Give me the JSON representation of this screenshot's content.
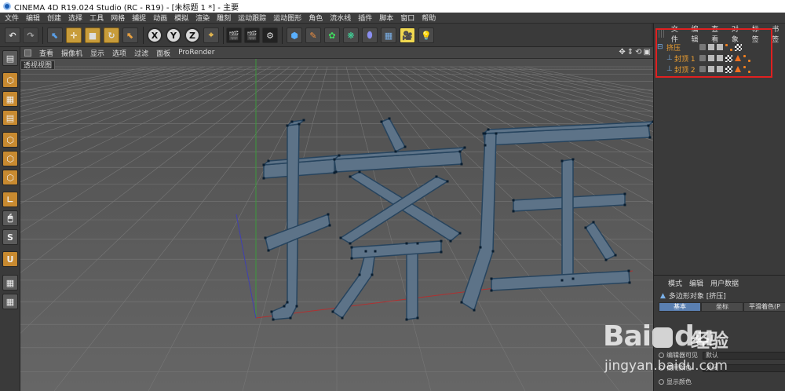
{
  "window": {
    "title": "CINEMA 4D R19.024 Studio (RC - R19) - [未标题 1 *] - 主要"
  },
  "menubar": [
    "文件",
    "编辑",
    "创建",
    "选择",
    "工具",
    "网格",
    "捕捉",
    "动画",
    "模拟",
    "渲染",
    "雕刻",
    "运动跟踪",
    "运动图形",
    "角色",
    "流水线",
    "插件",
    "脚本",
    "窗口",
    "帮助"
  ],
  "toolbar": {
    "axis_x": "X",
    "axis_y": "Y",
    "axis_z": "Z"
  },
  "viewport": {
    "menu": [
      "查看",
      "摄像机",
      "显示",
      "选项",
      "过滤",
      "面板",
      "ProRender"
    ],
    "label": "透视视图",
    "nav_icons": [
      "move-icon",
      "zoom-icon",
      "rotate-icon",
      "maximize-icon"
    ]
  },
  "object_manager": {
    "menu": [
      "文件",
      "编辑",
      "查看",
      "对象",
      "标签",
      "书签"
    ],
    "objects": [
      {
        "name": "挤压",
        "level": 0
      },
      {
        "name": "封顶 1",
        "level": 1
      },
      {
        "name": "封顶 2",
        "level": 1
      }
    ]
  },
  "attribute_manager": {
    "menu": [
      "模式",
      "编辑",
      "用户数据"
    ],
    "title": "多边形对象 [挤压]",
    "tabs": [
      "基本",
      "坐标",
      "平滑着色(P"
    ],
    "fields": [
      {
        "label": "编辑器可见",
        "value": "默认"
      },
      {
        "label": "使用颜色",
        "value": "关闭"
      },
      {
        "label": "显示颜色",
        "value": ""
      }
    ]
  },
  "watermark": {
    "logo": "Bai",
    "logo_tail": "du",
    "subtitle": "经验",
    "url": "jingyan.baidu.com"
  },
  "colors": {
    "selection_highlight": "#e02020",
    "object_name": "#f0a030",
    "active_tab": "#5a7fb0",
    "extrude_fill": "#5d7388",
    "extrude_edge": "#27445e"
  }
}
